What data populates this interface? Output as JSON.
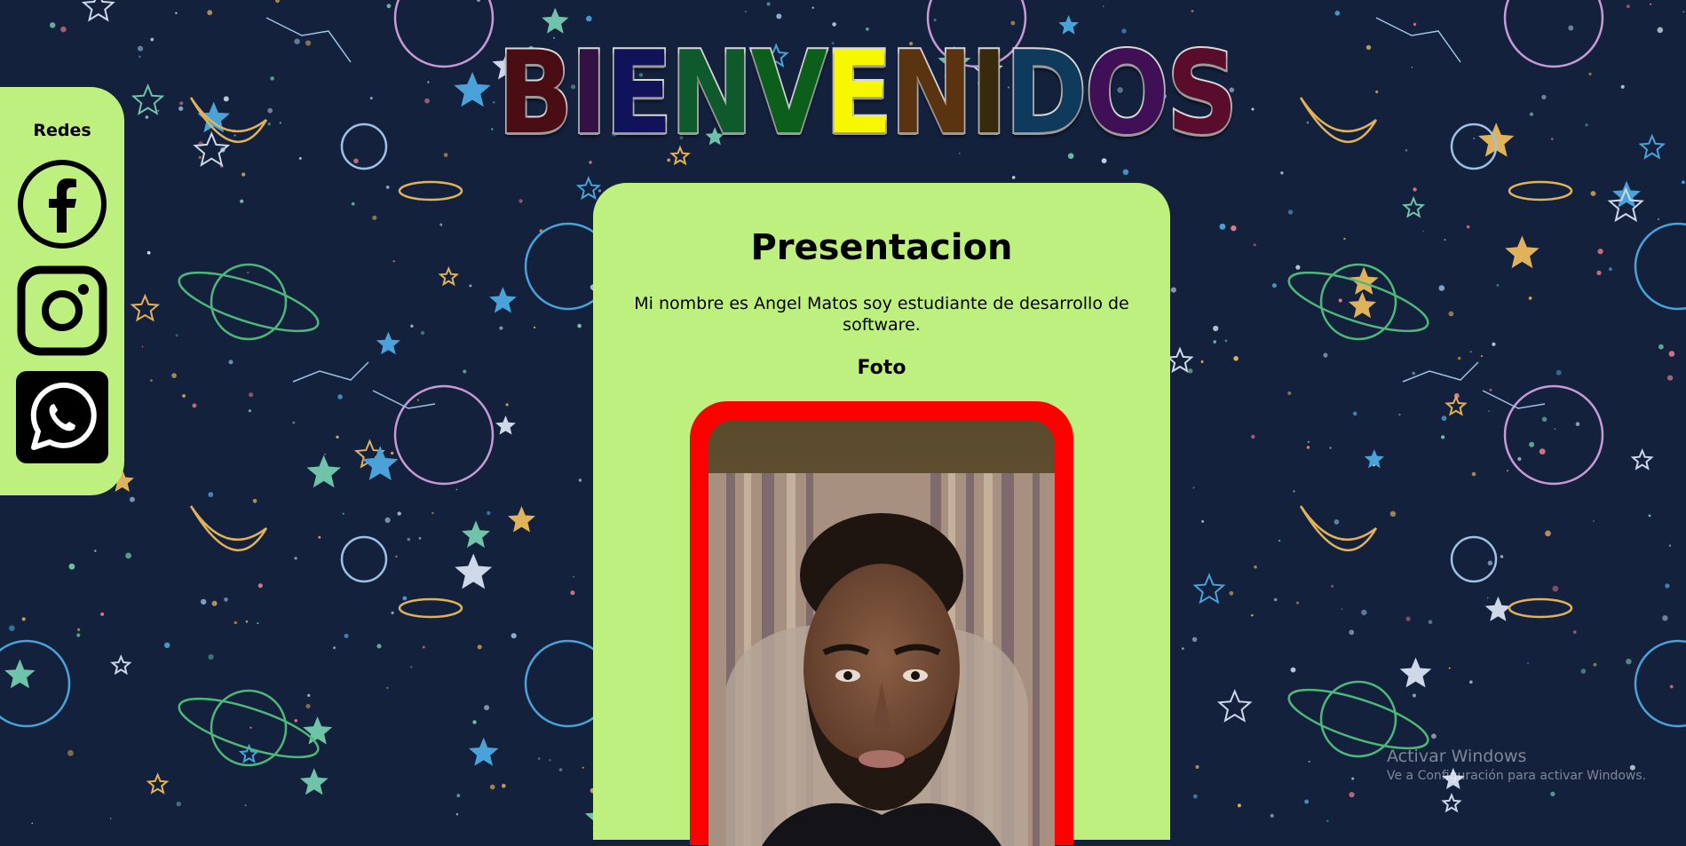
{
  "header": {
    "title_letters": [
      {
        "char": "B",
        "color": "#4a0d14"
      },
      {
        "char": "I",
        "color": "#351045"
      },
      {
        "char": "E",
        "color": "#10125a"
      },
      {
        "char": "N",
        "color": "#0f5a2c"
      },
      {
        "char": "V",
        "color": "#0c5e1b"
      },
      {
        "char": "E",
        "color": "#f7f700"
      },
      {
        "char": "N",
        "color": "#5a3410"
      },
      {
        "char": "I",
        "color": "#3a2a0c"
      },
      {
        "char": "D",
        "color": "#0f3a5c"
      },
      {
        "char": "O",
        "color": "#3f1055"
      },
      {
        "char": "S",
        "color": "#5a0d2b"
      }
    ]
  },
  "sidebar": {
    "title": "Redes",
    "links": [
      {
        "icon": "facebook-icon"
      },
      {
        "icon": "instagram-icon"
      },
      {
        "icon": "whatsapp-icon"
      }
    ]
  },
  "main": {
    "title": "Presentacion",
    "text": "Mi nombre es Angel Matos soy estudiante de desarrollo de software.",
    "photo_heading": "Foto",
    "photo_border_color": "#ff0000"
  },
  "watermark": {
    "line1": "Activar Windows",
    "line2": "Ve a Configuración para activar Windows."
  },
  "colors": {
    "background": "#14213d",
    "panel": "#bdf07f"
  }
}
